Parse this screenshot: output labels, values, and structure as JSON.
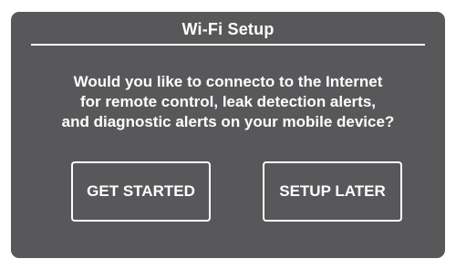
{
  "dialog": {
    "title": "Wi-Fi Setup",
    "message_lines": [
      "Would you like to connecto to the Internet",
      "for remote control, leak detection alerts,",
      "and diagnostic alerts on your mobile device?"
    ],
    "buttons": {
      "get_started": "GET STARTED",
      "setup_later": "SETUP LATER"
    }
  },
  "colors": {
    "panel_background": "#58585a",
    "text": "#ffffff",
    "page_background": "#ffffff"
  }
}
